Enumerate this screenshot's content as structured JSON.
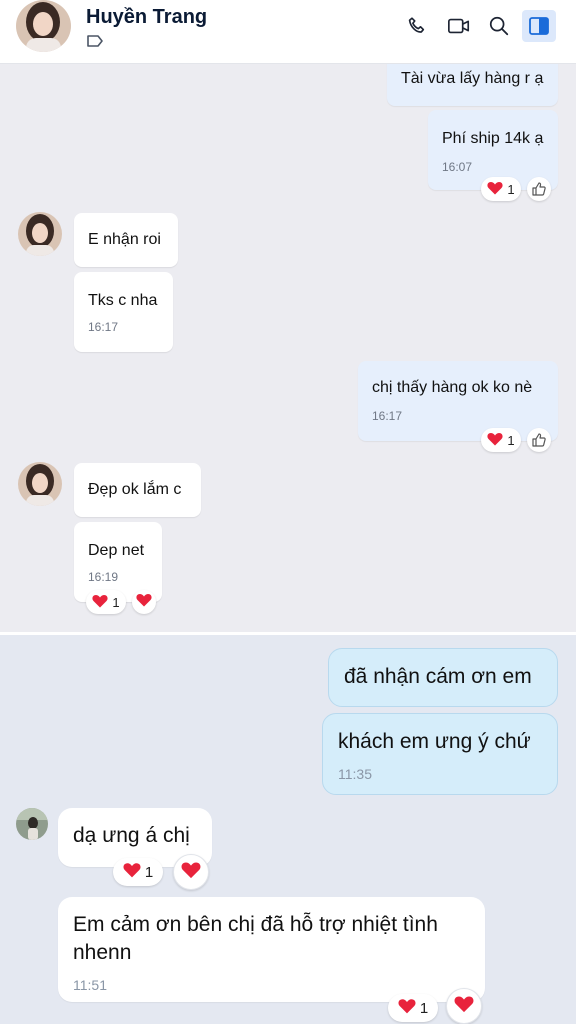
{
  "header": {
    "contact_name": "Huyền Trang",
    "icons": [
      "phone-icon",
      "video-call-icon",
      "search-icon",
      "sidebar-toggle-icon"
    ],
    "accent": "#1a6bd9"
  },
  "chat_top": {
    "messages": [
      {
        "id": "m1",
        "dir": "out",
        "text": "Tài vừa lấy hàng r ạ"
      },
      {
        "id": "m2",
        "dir": "out",
        "text": "Phí ship 14k ạ",
        "time": "16:07",
        "reaction_count": "1"
      },
      {
        "id": "m3",
        "dir": "in",
        "text": "E nhận roi"
      },
      {
        "id": "m4",
        "dir": "in",
        "text": "Tks c nha",
        "time": "16:17"
      },
      {
        "id": "m5",
        "dir": "out",
        "text": "chị thấy hàng ok ko nè",
        "time": "16:17",
        "reaction_count": "1"
      },
      {
        "id": "m6",
        "dir": "in",
        "text": "Đẹp ok lắm c"
      },
      {
        "id": "m7",
        "dir": "in",
        "text": "Dep net",
        "time": "16:19",
        "reaction_count": "1"
      }
    ]
  },
  "chat_bottom": {
    "messages": [
      {
        "id": "n1",
        "dir": "out",
        "text": "đã nhận cám ơn em"
      },
      {
        "id": "n2",
        "dir": "out",
        "text": "khách em ưng ý chứ",
        "time": "11:35"
      },
      {
        "id": "n3",
        "dir": "in",
        "text": "dạ ưng á chị",
        "reaction_count": "1"
      },
      {
        "id": "n4",
        "dir": "in",
        "text_line1": "Em cảm ơn bên chị đã hỗ trợ nhiệt tình",
        "text_line2": "nhenn",
        "time": "11:51",
        "reaction_count": "1"
      }
    ]
  },
  "colors": {
    "heart": "#e8233c",
    "bubble_out_top": "#e6effc",
    "bubble_out_bottom": "#d5edfa"
  }
}
